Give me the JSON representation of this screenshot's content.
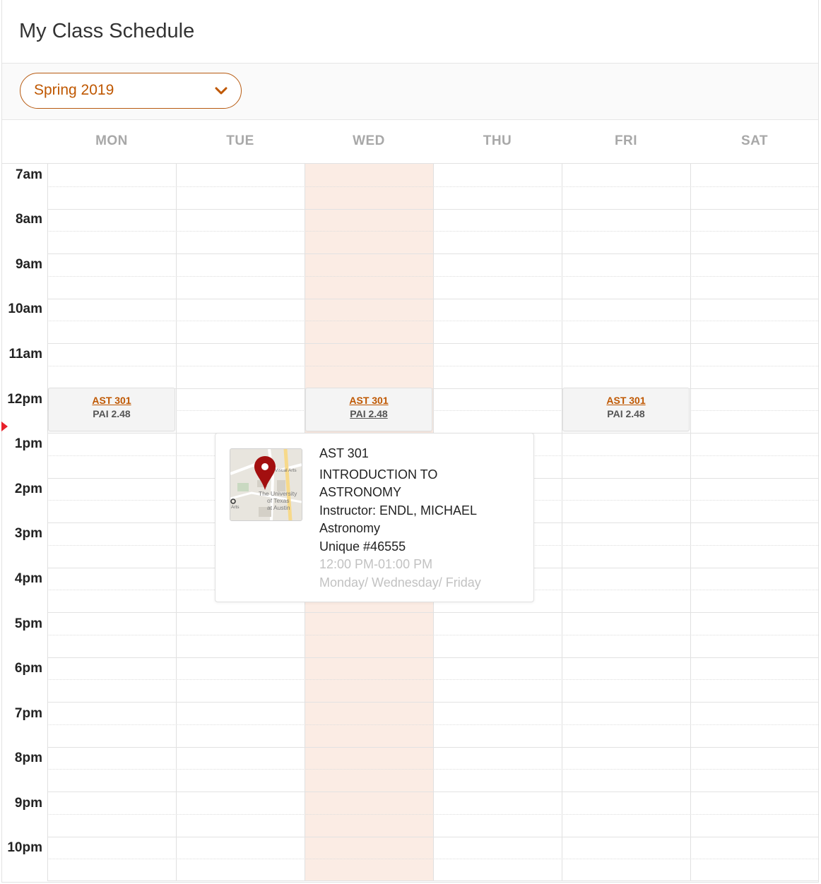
{
  "page": {
    "title": "My Class Schedule"
  },
  "semester_select": {
    "value": "Spring 2019"
  },
  "days": [
    "MON",
    "TUE",
    "WED",
    "THU",
    "FRI",
    "SAT"
  ],
  "hours": [
    "7am",
    "8am",
    "9am",
    "10am",
    "11am",
    "12pm",
    "1pm",
    "2pm",
    "3pm",
    "4pm",
    "5pm",
    "6pm",
    "7pm",
    "8pm",
    "9pm",
    "10pm"
  ],
  "events": [
    {
      "day": "MON",
      "course": "AST 301",
      "room": "PAI 2.48"
    },
    {
      "day": "WED",
      "course": "AST 301",
      "room": "PAI 2.48"
    },
    {
      "day": "FRI",
      "course": "AST 301",
      "room": "PAI 2.48"
    }
  ],
  "popup": {
    "course": "AST 301",
    "title_line1": "INTRODUCTION TO",
    "title_line2": "ASTRONOMY",
    "instructor": "Instructor: ENDL, MICHAEL",
    "department": "Astronomy",
    "unique": "Unique #46555",
    "time": "12:00 PM-01:00 PM",
    "days": "Monday/ Wednesday/ Friday",
    "map_labels": {
      "label1": "Visual Arts",
      "label2": "The University",
      "label3": "of Texas",
      "label4": "at Austin",
      "label5": "Arts"
    }
  },
  "icons": {
    "chevron": "chevron-down-icon",
    "map_pin": "map-pin-icon"
  },
  "colors": {
    "accent": "#bf5700",
    "today_column": "#fbece4",
    "now_marker": "#e8212a",
    "pin": "#a30f0f"
  }
}
